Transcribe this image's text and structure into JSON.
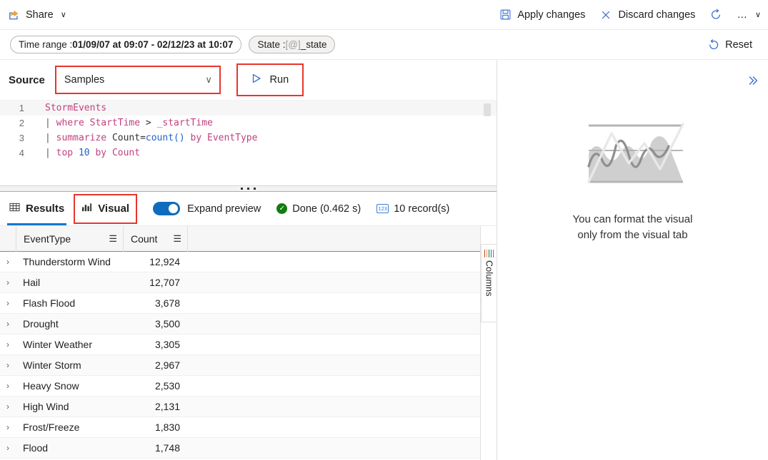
{
  "commandbar": {
    "share": {
      "label": "Share",
      "icon": "share-icon",
      "chevron": "∨"
    },
    "apply": {
      "label": "Apply changes",
      "icon": "save-icon"
    },
    "discard": {
      "label": "Discard changes",
      "icon": "close-icon"
    },
    "refresh": {
      "icon": "refresh-icon"
    },
    "overflow": {
      "label": "…",
      "chevron": "∨"
    }
  },
  "pillbar": {
    "time_range": {
      "prefix": "Time range : ",
      "value": "01/09/07 at 09:07 - 02/12/23 at 10:07"
    },
    "state": {
      "prefix": "State : ",
      "token": "[@]",
      "value": "_state"
    },
    "reset": {
      "label": "Reset",
      "icon": "undo-icon"
    }
  },
  "source": {
    "label": "Source",
    "selected": "Samples",
    "chevron": "∨",
    "run": {
      "label": "Run",
      "icon": "play-icon"
    }
  },
  "editor": {
    "lines": [
      {
        "num": "1",
        "current": true,
        "tokens": [
          {
            "t": "StormEvents",
            "c": "t-tbl"
          }
        ]
      },
      {
        "num": "2",
        "current": false,
        "tokens": [
          {
            "t": "| ",
            "c": "t-pipe"
          },
          {
            "t": "where ",
            "c": "t-kw"
          },
          {
            "t": "StartTime ",
            "c": "t-col"
          },
          {
            "t": "> ",
            "c": "t-op"
          },
          {
            "t": "_startTime",
            "c": "t-var"
          }
        ]
      },
      {
        "num": "3",
        "current": false,
        "tokens": [
          {
            "t": "| ",
            "c": "t-pipe"
          },
          {
            "t": "summarize ",
            "c": "t-kw"
          },
          {
            "t": "Count=",
            "c": "t-plain"
          },
          {
            "t": "count()",
            "c": "t-fn"
          },
          {
            "t": " by ",
            "c": "t-kw"
          },
          {
            "t": "EventType",
            "c": "t-col"
          }
        ]
      },
      {
        "num": "4",
        "current": false,
        "tokens": [
          {
            "t": "| ",
            "c": "t-pipe"
          },
          {
            "t": "top ",
            "c": "t-kw"
          },
          {
            "t": "10",
            "c": "t-num"
          },
          {
            "t": " by ",
            "c": "t-kw"
          },
          {
            "t": "Count",
            "c": "t-col"
          }
        ]
      }
    ]
  },
  "results": {
    "tabs": [
      {
        "label": "Results",
        "icon": "table-icon",
        "active": true,
        "annotated": false
      },
      {
        "label": "Visual",
        "icon": "chart-icon",
        "active": false,
        "annotated": true
      }
    ],
    "expand_preview_label": "Expand preview",
    "expand_preview_on": true,
    "status": "Done (0.462 s)",
    "records": "10 record(s)",
    "columns": [
      {
        "key": "EventType",
        "label": "EventType"
      },
      {
        "key": "Count",
        "label": "Count"
      }
    ],
    "rows": [
      {
        "EventType": "Thunderstorm Wind",
        "Count": "12,924"
      },
      {
        "EventType": "Hail",
        "Count": "12,707"
      },
      {
        "EventType": "Flash Flood",
        "Count": "3,678"
      },
      {
        "EventType": "Drought",
        "Count": "3,500"
      },
      {
        "EventType": "Winter Weather",
        "Count": "3,305"
      },
      {
        "EventType": "Winter Storm",
        "Count": "2,967"
      },
      {
        "EventType": "Heavy Snow",
        "Count": "2,530"
      },
      {
        "EventType": "High Wind",
        "Count": "2,131"
      },
      {
        "EventType": "Frost/Freeze",
        "Count": "1,830"
      },
      {
        "EventType": "Flood",
        "Count": "1,748"
      }
    ],
    "columns_tab_label": "Columns"
  },
  "visual_pane": {
    "expand_icon": "»",
    "placeholder_icon": "chart-placeholder-icon",
    "message_line1": "You can format the visual",
    "message_line2": "only from the visual tab"
  },
  "colors": {
    "accent": "#0078d4",
    "annotation": "#e8352c",
    "toggle_on": "#0f6cbd",
    "success": "#107c10",
    "keyword": "#c2407f",
    "function": "#1f63c8"
  }
}
